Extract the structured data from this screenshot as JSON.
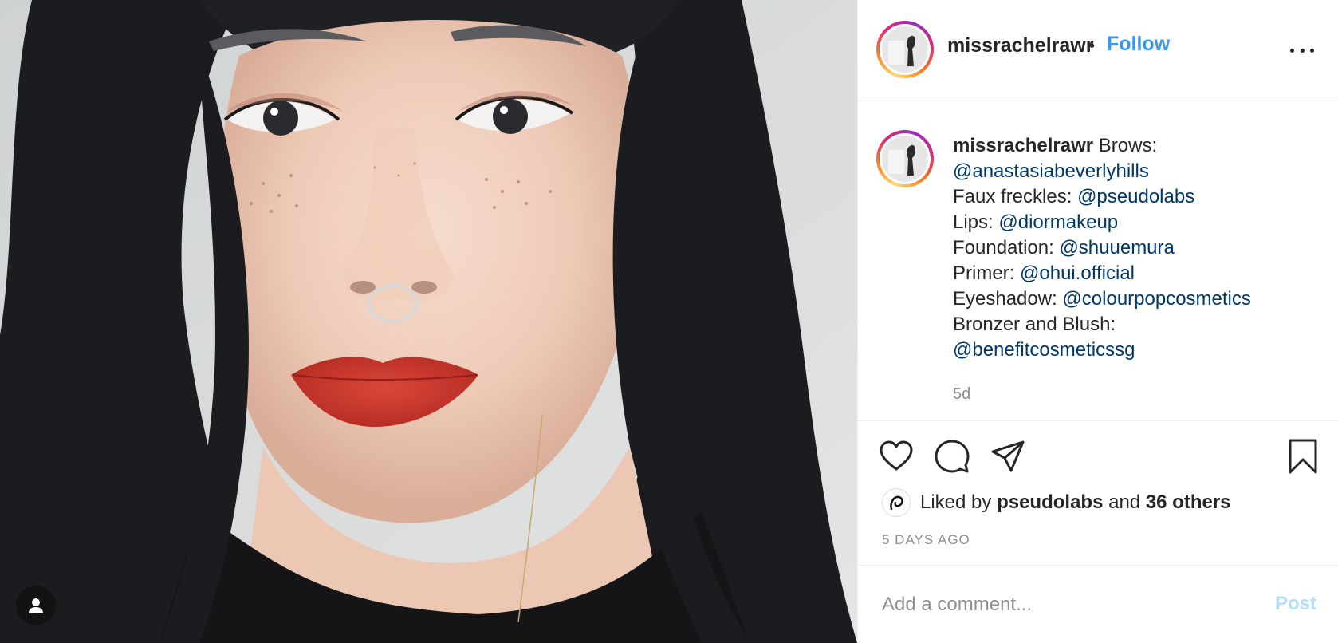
{
  "header": {
    "username": "missrachelrawr",
    "separator": "•",
    "follow_label": "Follow",
    "more_icon": "more-horizontal-icon"
  },
  "caption": {
    "username": "missrachelrawr",
    "lines": [
      {
        "label": "Brows:",
        "mention": "@anastasiabeverlyhills"
      },
      {
        "label": "Faux freckles:",
        "mention": "@pseudolabs"
      },
      {
        "label": "Lips:",
        "mention": "@diormakeup"
      },
      {
        "label": "Foundation:",
        "mention": "@shuuemura"
      },
      {
        "label": "Primer:",
        "mention": "@ohui.official"
      },
      {
        "label": "Eyeshadow:",
        "mention": "@colourpopcosmetics"
      },
      {
        "label": "Bronzer and Blush:",
        "mention": "@benefitcosmeticssg"
      }
    ],
    "age": "5d"
  },
  "actions": {
    "like_icon": "heart-icon",
    "comment_icon": "comment-icon",
    "share_icon": "send-icon",
    "save_icon": "bookmark-icon"
  },
  "likes": {
    "prefix": "Liked by",
    "user": "pseudolabs",
    "conj": "and",
    "others": "36 others"
  },
  "timestamp": "5 DAYS AGO",
  "comment": {
    "placeholder": "Add a comment...",
    "post_label": "Post"
  },
  "photo": {
    "tag_icon": "user-tag-icon"
  },
  "colors": {
    "link": "#3897f0",
    "mention": "#00376b",
    "post_disabled": "#b2dffc",
    "lips": "#c8352b"
  }
}
